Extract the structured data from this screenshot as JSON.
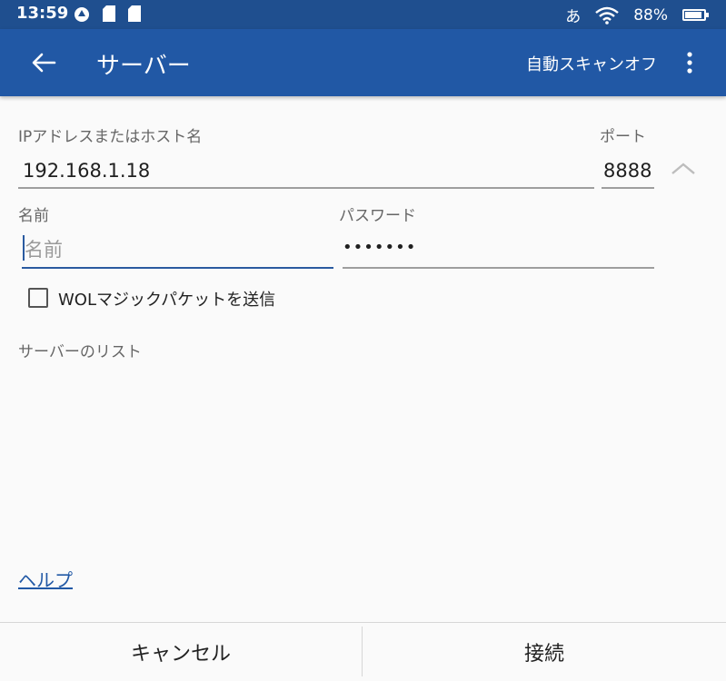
{
  "status_bar": {
    "time": "13:59",
    "ime": "あ",
    "battery": "88%",
    "battery_level": 0.88
  },
  "app_bar": {
    "title": "サーバー",
    "action": "自動スキャンオフ"
  },
  "form": {
    "host_label": "IPアドレスまたはホスト名",
    "host_value": "192.168.1.18",
    "port_label": "ポート",
    "port_value": "8888",
    "name_label": "名前",
    "name_placeholder": "名前",
    "password_label": "パスワード",
    "password_value": "•••••••",
    "wol_label": "WOLマジックパケットを送信"
  },
  "server_list": {
    "header": "サーバーのリスト"
  },
  "help_link": "ヘルプ",
  "buttons": {
    "cancel": "キャンセル",
    "connect": "接続"
  },
  "colors": {
    "appbar": "#2158a5",
    "statusbar": "#1f4f8f",
    "accent": "#2a5aa0"
  }
}
